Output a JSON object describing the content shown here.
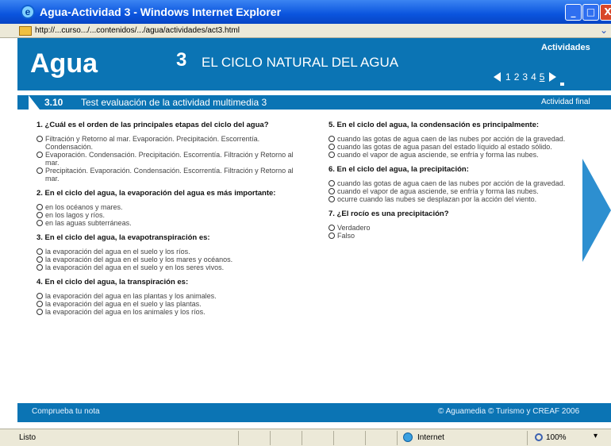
{
  "window": {
    "title": "Agua-Actividad 3 - Windows Internet Explorer",
    "minimize": "_",
    "maximize": "□",
    "close": "X"
  },
  "address": {
    "url": "http://...curso.../...contenidos/.../agua/actividades/act3.html",
    "dropdown": "⌄"
  },
  "header": {
    "logo": "Agua",
    "unit_number": "3",
    "unit_title": "EL CICLO NATURAL DEL AGUA",
    "activities_label": "Actividades",
    "pages": [
      "1",
      "2",
      "3",
      "4",
      "5"
    ],
    "current_page": "5"
  },
  "section": {
    "number": "3.10",
    "title": "Test evaluación de la actividad multimedia 3",
    "tag": "Actividad final"
  },
  "questions_left": [
    {
      "text": "1. ¿Cuál es el orden de las principales etapas del ciclo del agua?",
      "options": [
        "Filtración y Retorno al mar. Evaporación. Precipitación. Escorrentía. Condensación.",
        "Evaporación. Condensación. Precipitación. Escorrentía. Filtración y Retorno al mar.",
        "Precipitación. Evaporación. Condensación. Escorrentía. Filtración y Retorno al mar."
      ]
    },
    {
      "text": "2. En el ciclo del agua, la evaporación del agua es más importante:",
      "options": [
        "en los océanos y mares.",
        "en los lagos y ríos.",
        "en las aguas subterráneas."
      ]
    },
    {
      "text": "3. En el ciclo del agua, la evapotranspiración es:",
      "options": [
        "la evaporación del agua en el suelo y los ríos.",
        "la evaporación del agua en el suelo y los mares y océanos.",
        "la evaporación del agua en el suelo y en los seres vivos."
      ]
    },
    {
      "text": "4. En el ciclo del agua, la transpiración es:",
      "options": [
        "la evaporación del agua en las plantas y los animales.",
        "la evaporación del agua en el suelo y las plantas.",
        "la evaporación del agua en los animales y los ríos."
      ]
    }
  ],
  "questions_right": [
    {
      "text": "5. En el ciclo del agua, la condensación es principalmente:",
      "options": [
        "cuando las gotas de agua caen de las nubes por acción de la gravedad.",
        "cuando las gotas de agua pasan del estado líquido al estado sólido.",
        "cuando el vapor de agua asciende, se enfría y forma las nubes."
      ]
    },
    {
      "text": "6. En el ciclo del agua, la precipitación:",
      "options": [
        "cuando las gotas de agua caen de las nubes por acción de la gravedad.",
        "cuando el vapor de agua asciende, se enfría y forma las nubes.",
        "ocurre cuando las nubes se desplazan por la acción del viento."
      ]
    },
    {
      "text": "7. ¿El rocío es una precipitación?",
      "options": [
        "Verdadero",
        "Falso"
      ]
    }
  ],
  "footer": {
    "check_label": "Comprueba tu nota",
    "copyright": "© Aguamedia © Turismo y CREAF 2006"
  },
  "status": {
    "done": "Listo",
    "zone": "Internet",
    "zoom": "100%",
    "zoom_arrow": "▾"
  },
  "colors": {
    "header_blue": "#0b74b4",
    "arrow_blue": "#2d8fd0",
    "titlebar_blue": "#0a54de"
  },
  "icons": {
    "browser": "ie-logo-icon",
    "page": "page-icon",
    "next": "next-arrow-icon",
    "zone": "globe-icon",
    "zoom": "zoom-icon"
  }
}
